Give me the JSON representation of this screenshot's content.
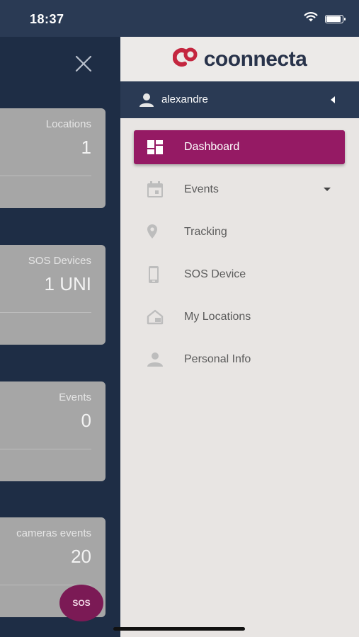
{
  "status_bar": {
    "time": "18:37"
  },
  "dashboard": {
    "cards": [
      {
        "label": "Locations",
        "value": "1"
      },
      {
        "label": "SOS Devices",
        "value": "1 UNI"
      },
      {
        "label": "Events",
        "value": "0"
      },
      {
        "label": "cameras events",
        "value": "20"
      }
    ],
    "sos_button_label": "SOS"
  },
  "drawer": {
    "brand": "coonnecta",
    "user": {
      "name": "alexandre"
    },
    "menu": [
      {
        "label": "Dashboard",
        "icon": "dashboard-icon",
        "active": true
      },
      {
        "label": "Events",
        "icon": "calendar-icon",
        "has_dropdown": true
      },
      {
        "label": "Tracking",
        "icon": "location-pin-icon"
      },
      {
        "label": "SOS Device",
        "icon": "phone-device-icon"
      },
      {
        "label": "My Locations",
        "icon": "home-icon"
      },
      {
        "label": "Personal Info",
        "icon": "person-icon"
      }
    ]
  },
  "colors": {
    "accent": "#951a64",
    "brand_red": "#c4263f",
    "dark_navy": "#2a3a54",
    "fab": "#7b1a55"
  }
}
